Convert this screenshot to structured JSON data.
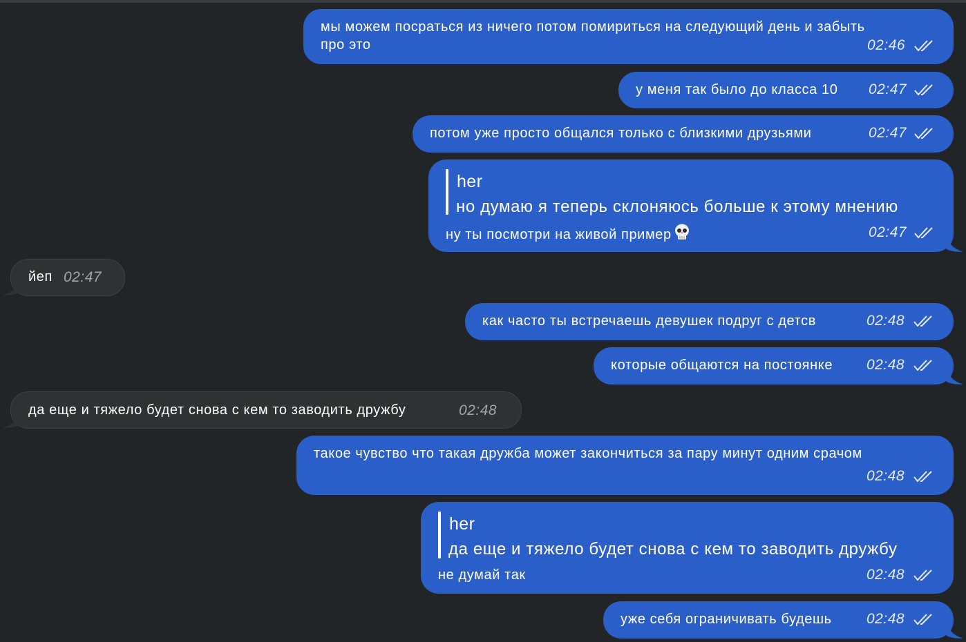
{
  "messages": [
    {
      "lines": [
        "мы можем посраться из ничего потом помириться на следующий день и забыть",
        "про это"
      ],
      "time": "02:46"
    },
    {
      "text": "у меня так было до класса 10",
      "time": "02:47"
    },
    {
      "text": "потом уже просто общался только с близкими друзьями",
      "time": "02:47"
    },
    {
      "reply_author": "her",
      "reply_text": "но думаю я теперь склоняюсь больше к этому мнению",
      "text": "ну ты посмотри на живой пример",
      "time": "02:47",
      "emoji": "skull-emoji"
    },
    {
      "text": "йеп",
      "time": "02:47"
    },
    {
      "text": "как часто ты встречаешь девушек подруг с детсв",
      "time": "02:48"
    },
    {
      "text": "которые общаются на постоянке",
      "time": "02:48"
    },
    {
      "text": "да еще и тяжело будет снова с кем то заводить дружбу",
      "time": "02:48"
    },
    {
      "text": "такое чувство что такая дружба может закончиться за пару минут одним срачом",
      "time": "02:48"
    },
    {
      "reply_author": "her",
      "reply_text": "да еще и тяжело будет снова с кем то заводить дружбу",
      "text": "не думай так",
      "time": "02:48"
    },
    {
      "text": "уже себя ограничивать будешь",
      "time": "02:48"
    }
  ],
  "colors": {
    "background": "#222527",
    "outgoing_bubble": "#2a5ec8",
    "incoming_bubble": "#2f3133"
  }
}
